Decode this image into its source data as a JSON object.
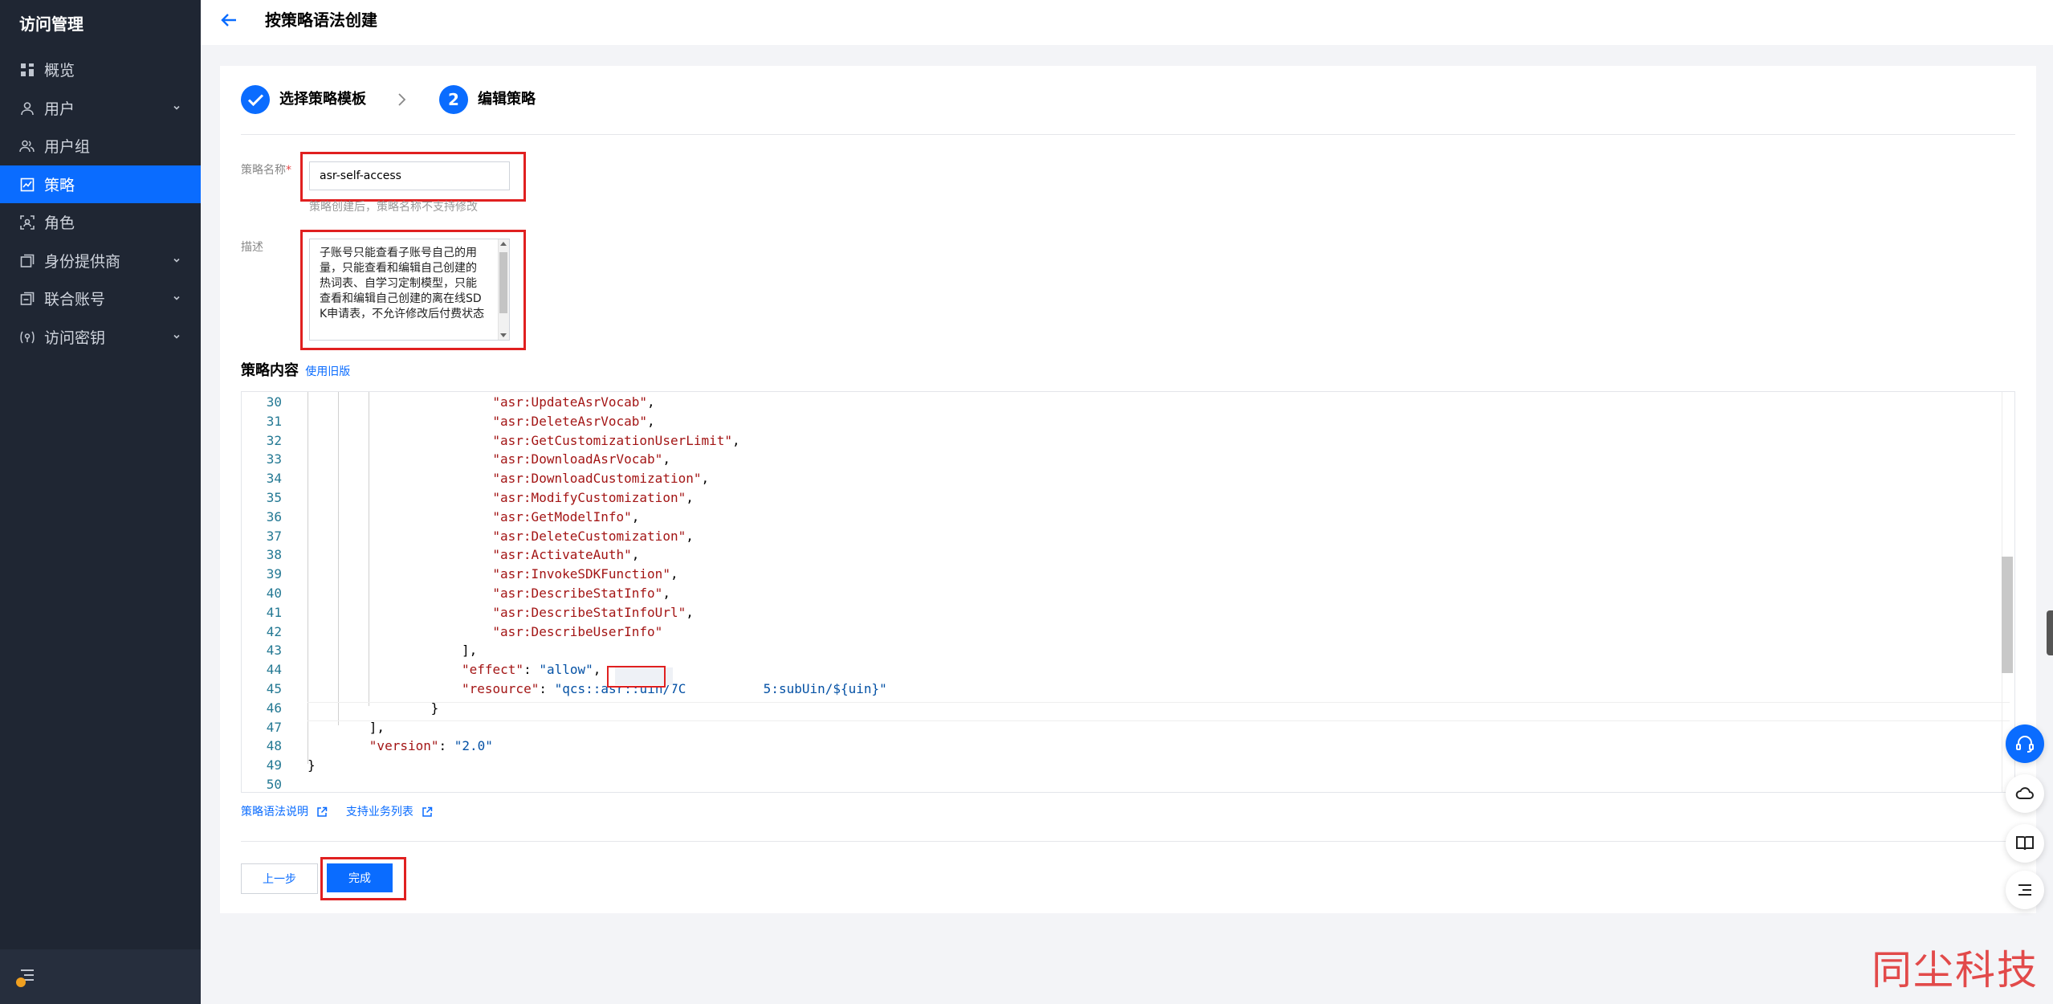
{
  "sidebar": {
    "title": "访问管理",
    "items": [
      {
        "label": "概览",
        "icon": "grid-icon",
        "has_arrow": false,
        "active": false
      },
      {
        "label": "用户",
        "icon": "user-icon",
        "has_arrow": true,
        "active": false
      },
      {
        "label": "用户组",
        "icon": "user-group-icon",
        "has_arrow": false,
        "active": false
      },
      {
        "label": "策略",
        "icon": "policy-icon",
        "has_arrow": false,
        "active": true
      },
      {
        "label": "角色",
        "icon": "role-icon",
        "has_arrow": false,
        "active": false
      },
      {
        "label": "身份提供商",
        "icon": "identity-provider-icon",
        "has_arrow": true,
        "active": false
      },
      {
        "label": "联合账号",
        "icon": "federated-account-icon",
        "has_arrow": true,
        "active": false
      },
      {
        "label": "访问密钥",
        "icon": "access-key-icon",
        "has_arrow": true,
        "active": false
      }
    ]
  },
  "header": {
    "title": "按策略语法创建"
  },
  "steps": [
    {
      "label": "选择策略模板",
      "state": "done"
    },
    {
      "label": "编辑策略",
      "number": "2",
      "state": "current"
    }
  ],
  "form": {
    "name_label": "策略名称",
    "required_mark": "*",
    "name_value": "asr-self-access",
    "name_hint": "策略创建后，策略名称不支持修改",
    "desc_label": "描述",
    "desc_value": "子账号只能查看子账号自己的用量，只能查看和编辑自己创建的热词表、自学习定制模型，只能查看和编辑自己创建的离在线SDK申请表，不允许修改后付费状态"
  },
  "content": {
    "title": "策略内容",
    "legacy_link": "使用旧版"
  },
  "code": [
    {
      "n": "30",
      "indent": 6,
      "key": "\"asr:UpdateAsrVocab\"",
      "rest": ","
    },
    {
      "n": "31",
      "indent": 6,
      "key": "\"asr:DeleteAsrVocab\"",
      "rest": ","
    },
    {
      "n": "32",
      "indent": 6,
      "key": "\"asr:GetCustomizationUserLimit\"",
      "rest": ","
    },
    {
      "n": "33",
      "indent": 6,
      "key": "\"asr:DownloadAsrVocab\"",
      "rest": ","
    },
    {
      "n": "34",
      "indent": 6,
      "key": "\"asr:DownloadCustomization\"",
      "rest": ","
    },
    {
      "n": "35",
      "indent": 6,
      "key": "\"asr:ModifyCustomization\"",
      "rest": ","
    },
    {
      "n": "36",
      "indent": 6,
      "key": "\"asr:GetModelInfo\"",
      "rest": ","
    },
    {
      "n": "37",
      "indent": 6,
      "key": "\"asr:DeleteCustomization\"",
      "rest": ","
    },
    {
      "n": "38",
      "indent": 6,
      "key": "\"asr:ActivateAuth\"",
      "rest": ","
    },
    {
      "n": "39",
      "indent": 6,
      "key": "\"asr:InvokeSDKFunction\"",
      "rest": ","
    },
    {
      "n": "40",
      "indent": 6,
      "key": "\"asr:DescribeStatInfo\"",
      "rest": ","
    },
    {
      "n": "41",
      "indent": 6,
      "key": "\"asr:DescribeStatInfoUrl\"",
      "rest": ","
    },
    {
      "n": "42",
      "indent": 6,
      "key": "\"asr:DescribeUserInfo\"",
      "rest": ""
    },
    {
      "n": "43",
      "indent": 5,
      "key": "",
      "rest": "],"
    },
    {
      "n": "44",
      "indent": 5,
      "key": "\"effect\"",
      "rest": ": ",
      "val": "\"allow\"",
      "tail": ","
    },
    {
      "n": "45",
      "indent": 5,
      "key": "\"resource\"",
      "rest": ": ",
      "val": "\"qcs::asr::uin/7C          5:subUin/${uin}\"",
      "tail": ""
    },
    {
      "n": "46",
      "indent": 4,
      "key": "",
      "rest": "}"
    },
    {
      "n": "47",
      "indent": 2,
      "key": "",
      "rest": "],"
    },
    {
      "n": "48",
      "indent": 2,
      "key": "\"version\"",
      "rest": ": ",
      "val": "\"2.0\"",
      "tail": ""
    },
    {
      "n": "49",
      "indent": 0,
      "key": "",
      "rest": "}"
    },
    {
      "n": "50",
      "indent": 0,
      "key": "",
      "rest": ""
    }
  ],
  "links": {
    "syntax": "策略语法说明",
    "services": "支持业务列表"
  },
  "buttons": {
    "prev": "上一步",
    "done": "完成"
  },
  "watermark": "同尘科技",
  "colors": {
    "sidebar_bg": "#1f2633",
    "accent": "#0a6cff",
    "highlight_box": "#e02020"
  }
}
